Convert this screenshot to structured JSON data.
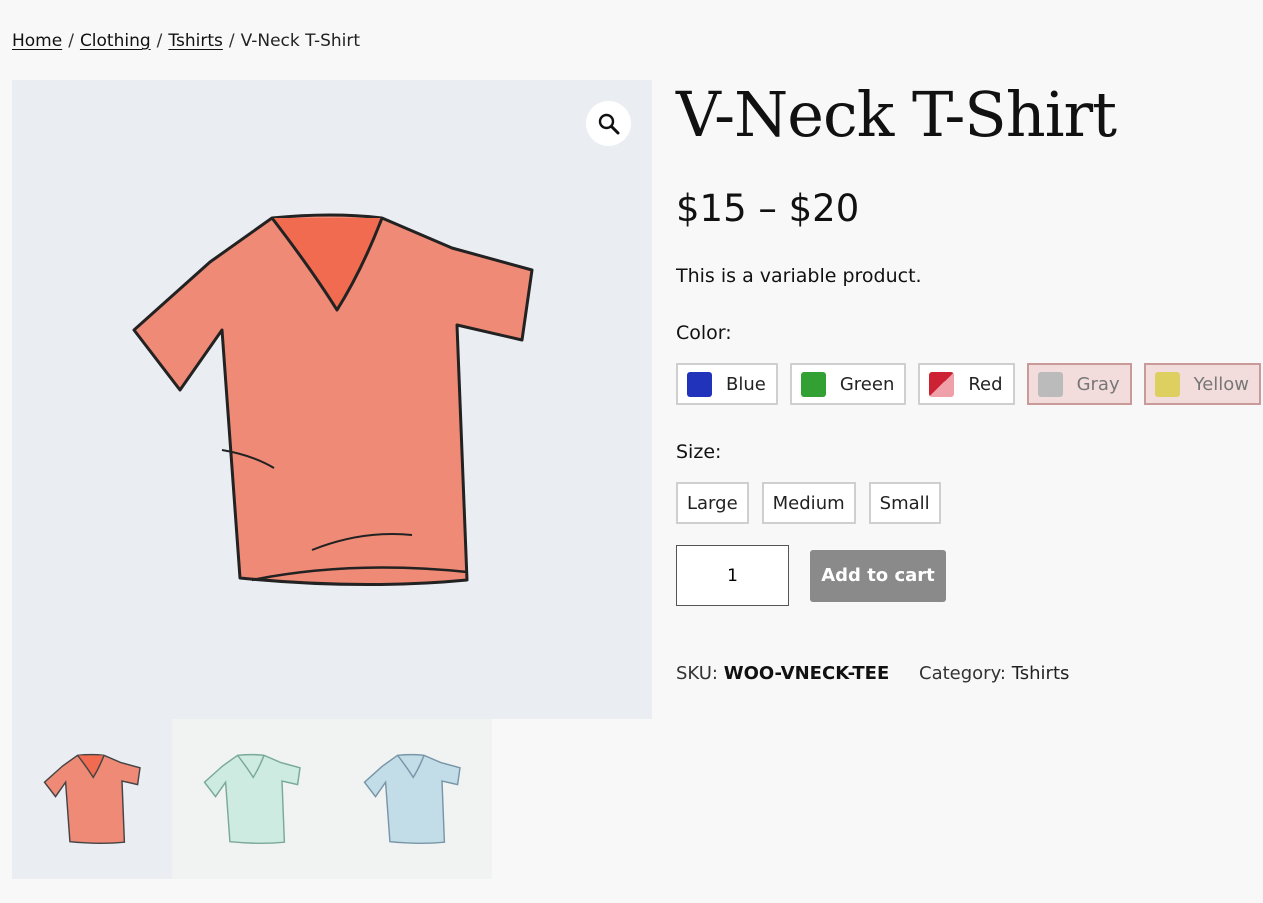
{
  "breadcrumb": {
    "home": "Home",
    "clothing": "Clothing",
    "tshirts": "Tshirts",
    "current": "V-Neck T-Shirt",
    "separator": "/"
  },
  "product": {
    "title": "V-Neck T-Shirt",
    "price": "$15 – $20",
    "short_description": "This is a variable product.",
    "main_image_color": "#ef8a76",
    "thumbnails": [
      {
        "name": "red",
        "color": "#ef8a76"
      },
      {
        "name": "green",
        "color": "#cdebe0"
      },
      {
        "name": "blue",
        "color": "#c3dde8"
      }
    ]
  },
  "color": {
    "label": "Color:",
    "options": [
      {
        "label": "Blue",
        "color": "#2233bb",
        "disabled": false
      },
      {
        "label": "Green",
        "color": "#33a033",
        "disabled": false
      },
      {
        "label": "Red",
        "color": "#cc2233",
        "disabled": false
      },
      {
        "label": "Gray",
        "color": "#bbbbbb",
        "disabled": true
      },
      {
        "label": "Yellow",
        "color": "#ddd060",
        "disabled": true
      }
    ]
  },
  "size": {
    "label": "Size:",
    "options": [
      "Large",
      "Medium",
      "Small"
    ]
  },
  "cart": {
    "quantity": "1",
    "button_label": "Add to cart"
  },
  "meta": {
    "sku_label": "SKU:",
    "sku": "WOO-VNECK-TEE",
    "category_label": "Category:",
    "category": "Tshirts"
  }
}
